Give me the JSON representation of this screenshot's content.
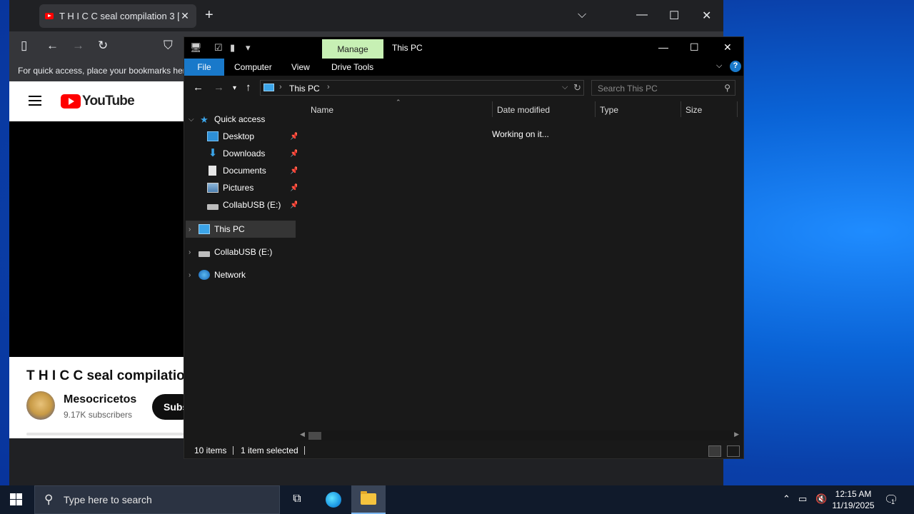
{
  "browser": {
    "tab": {
      "title": "T H I C C seal compilation 3 [&",
      "close": "✕"
    },
    "newtab": "+",
    "controls": {
      "dropdown": "⌵",
      "minimize": "—",
      "maximize": "☐",
      "close": "✕"
    },
    "toolbar": {
      "sidebar": "▯",
      "back": "←",
      "forward": "→",
      "reload": "↻",
      "shield": "⛉"
    },
    "bookmarks_hint": "For quick access, place your bookmarks here",
    "youtube": {
      "logo": "YouTube",
      "video_title": "T H I C C seal compilatio",
      "channel": "Mesocricetos",
      "subscribers": "9.17K subscribers",
      "subscribe_label": "Subs"
    }
  },
  "explorer": {
    "title": "This PC",
    "manage_tab": "Manage",
    "ribbon_tabs": [
      "File",
      "Computer",
      "View",
      "Drive Tools"
    ],
    "help": "?",
    "address": {
      "crumb": "This PC"
    },
    "search_placeholder": "Search This PC",
    "nav": {
      "quick_access": "Quick access",
      "desktop": "Desktop",
      "downloads": "Downloads",
      "documents": "Documents",
      "pictures": "Pictures",
      "collab_pinned": "CollabUSB (E:)",
      "this_pc": "This PC",
      "collab_drive": "CollabUSB (E:)",
      "network": "Network"
    },
    "columns": {
      "name": "Name",
      "date": "Date modified",
      "type": "Type",
      "size": "Size"
    },
    "loading_text": "Working on it...",
    "status": {
      "items": "10 items",
      "selected": "1 item selected"
    }
  },
  "taskbar": {
    "search_placeholder": "Type here to search",
    "time": "12:15 AM",
    "date": "11/19/2025",
    "notification_count": "1"
  },
  "colors": {
    "accent_blue": "#1979ca",
    "manage_green": "#c7f0b4",
    "youtube_red": "#ff0000"
  }
}
